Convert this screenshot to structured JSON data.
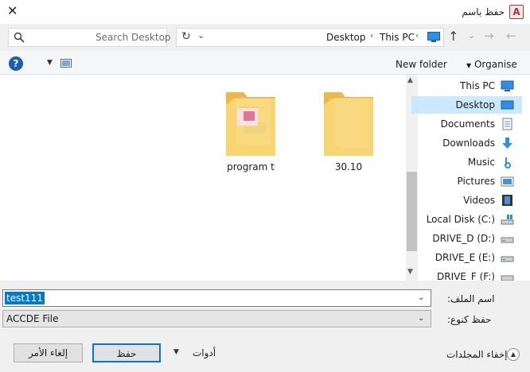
{
  "window": {
    "title": "حفظ باسم",
    "app_icon_letter": "A"
  },
  "search": {
    "placeholder": "Search Desktop"
  },
  "address": {
    "crumbs": [
      "Desktop",
      "This PC"
    ]
  },
  "toolbar": {
    "new_folder": "New folder",
    "organise": "Organise",
    "organise_arrow": "▼"
  },
  "files": [
    {
      "name": "program t"
    },
    {
      "name": "30.10"
    }
  ],
  "navpane": {
    "items": [
      {
        "label": "This PC",
        "icon": "computer-icon",
        "selected": false
      },
      {
        "label": "Desktop",
        "icon": "desktop-icon",
        "selected": true
      },
      {
        "label": "Documents",
        "icon": "documents-icon",
        "selected": false
      },
      {
        "label": "Downloads",
        "icon": "downloads-icon",
        "selected": false
      },
      {
        "label": "Music",
        "icon": "music-icon",
        "selected": false
      },
      {
        "label": "Pictures",
        "icon": "pictures-icon",
        "selected": false
      },
      {
        "label": "Videos",
        "icon": "videos-icon",
        "selected": false
      },
      {
        "label": "Local Disk (C:)",
        "icon": "drive-c-icon",
        "selected": false
      },
      {
        "label": "DRIVE_D (D:)",
        "icon": "drive-icon",
        "selected": false
      },
      {
        "label": "DRIVE_E (E:)",
        "icon": "drive-icon",
        "selected": false
      },
      {
        "label": "DRIVE_F (F:)",
        "icon": "drive-icon",
        "selected": false
      }
    ]
  },
  "form": {
    "filename_label": "اسم الملف:",
    "filename_value": "test111",
    "savetype_label": "حفظ كنوع:",
    "savetype_value": "ACCDE File"
  },
  "footer": {
    "hide_folders": "إخفاء المجلدات",
    "tools": "أدوات",
    "save": "حفظ",
    "cancel": "إلغاء الأمر"
  },
  "colors": {
    "accent": "#0078d7",
    "selection": "#cce8ff",
    "folder": "#f8d775"
  }
}
